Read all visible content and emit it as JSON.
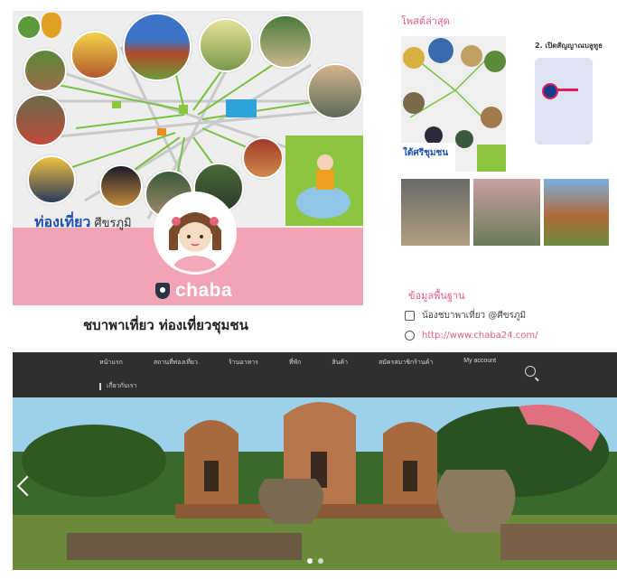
{
  "cover": {
    "heading_main": "ท่องเที่ยว",
    "heading_sub": "ศีขรภูมิ",
    "brand": "chaba"
  },
  "page": {
    "title": "ชบาพาเที่ยว ท่องเที่ยวชุมชน"
  },
  "sidebar": {
    "latest_photos_title": "โพสต์ล่าสุด",
    "info_title": "ข้อมูลพื้นฐาน",
    "info_items": [
      {
        "icon": "instagram-icon",
        "text": "น้องชบาพาเที่ยว @ศีขรภูมิ"
      },
      {
        "icon": "globe-icon",
        "text": "http://www.chaba24.com/"
      }
    ],
    "thumb_caption": "2. เปิดสัญญาณบลูทูธ"
  },
  "site_nav": {
    "items": [
      "หน้าแรก",
      "สถานที่ท่องเที่ยว",
      "ร้านอาหาร",
      "ที่พัก",
      "สินค้า",
      "สมัครสมาชิกร้านค้า",
      "My account"
    ],
    "second_row": "เกี่ยวกับเรา"
  },
  "colors": {
    "pink": "#f2a3b5",
    "accent": "#e05a8a",
    "nav_bg": "#2f2f2f",
    "heading_blue": "#1f4fb0"
  }
}
